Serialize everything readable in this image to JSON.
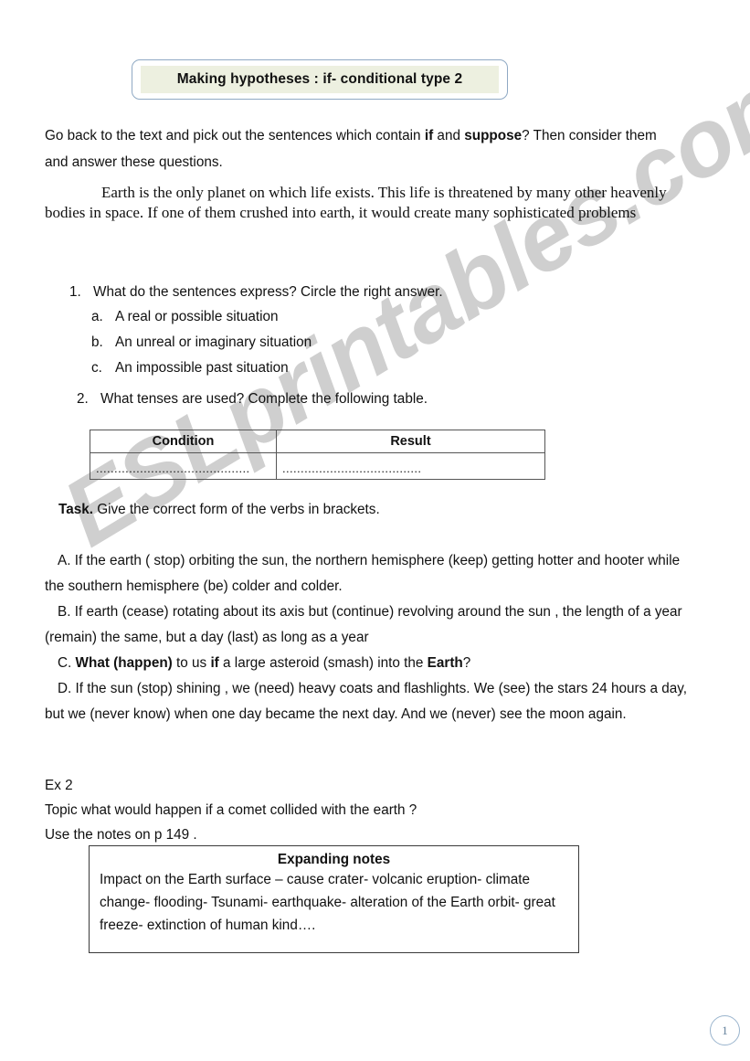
{
  "watermark": {
    "text": "ESLprintables.com"
  },
  "header": {
    "title": "Making hypotheses : if- conditional type 2"
  },
  "intro": {
    "part1": "Go back to the text and pick out the sentences which contain ",
    "bold1": "if",
    "part2": " and ",
    "bold2": "suppose",
    "part3": "? Then consider them and answer these questions."
  },
  "reading_passage": {
    "text": "Earth  is the only planet on which life exists. This life is threatened by many other heavenly bodies in space. If one of them crushed  into earth, it  would create  many sophisticated problems"
  },
  "questions": [
    {
      "num": "1.",
      "text": "What do the sentences express? Circle the right answer."
    },
    {
      "num": "2.",
      "text": "What tenses are used? Complete the following table."
    }
  ],
  "options": [
    {
      "letter": "a.",
      "text": "A real or possible situation"
    },
    {
      "letter": "b.",
      "text": "An unreal or imaginary situation"
    },
    {
      "letter": "c.",
      "text": "An impossible past situation"
    }
  ],
  "table": {
    "headers": [
      "Condition",
      "Result"
    ],
    "rows": [
      [
        "..........................................",
        "......................................"
      ]
    ]
  },
  "task": {
    "label": "Task.",
    "instruction": " Give the correct form of the verbs in brackets."
  },
  "verb_items": {
    "a": "A. If the earth ( stop) orbiting the sun, the northern hemisphere    (keep) getting hotter and hooter while the southern hemisphere (be) colder and colder.",
    "b": "B. If earth (cease) rotating about its axis but (continue)  revolving  around the sun , the length of a year (remain) the same, but a day   (last)  as long as a year",
    "c_prefix": "C. ",
    "c_bold1": "What (happen)",
    "c_mid1": " to us ",
    "c_bold2": "if",
    "c_mid2": " a large asteroid (smash) into the   ",
    "c_bold3": "Earth",
    "c_suffix": "?",
    "d": "D. If the sun (stop) shining , we (need) heavy coats and flashlights.  We (see) the stars 24 hours a day, but we (never know) when   one day became the next day. And we (never) see the moon    again."
  },
  "ex2": {
    "label": "Ex 2",
    "topic": "Topic what would happen if a comet collided with the earth   ?",
    "notes_ref": "Use the notes on p 149 ."
  },
  "notes_box": {
    "title": "Expanding notes",
    "body": "Impact on the Earth surface – cause crater- volcanic eruption- climate change- flooding- Tsunami- earthquake- alteration of the Earth orbit- great freeze- extinction of human kind…."
  },
  "footer": {
    "page_number": "1"
  },
  "colors": {
    "title_border": "#8fa9c4",
    "title_fill": "#edf0e0",
    "watermark": "#cfcfcf",
    "badge_border": "#9ab4cd"
  }
}
